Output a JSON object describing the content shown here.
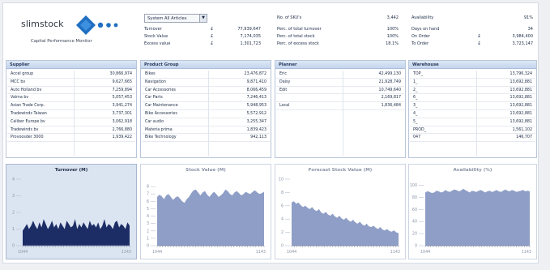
{
  "brand": {
    "name": "slimstock",
    "tagline": "Capital Performance Monitor"
  },
  "filter": {
    "selected": "System All Articles"
  },
  "summary_left": [
    {
      "label": "Turnover",
      "cur": "£",
      "value": "77,939,647"
    },
    {
      "label": "Stock Value",
      "cur": "£",
      "value": "7,174,035"
    },
    {
      "label": "Excess value",
      "cur": "£",
      "value": "1,301,723"
    }
  ],
  "summary_mid": [
    {
      "label": "No. of SKU's",
      "value": "3,442"
    },
    {
      "label": "Perc. of total turnover",
      "value": "100%"
    },
    {
      "label": "Perc. of total stock",
      "value": "100%"
    },
    {
      "label": "Perc. of excess stock",
      "value": "18.1%"
    }
  ],
  "summary_right": [
    {
      "label": "Availability",
      "cur": "",
      "value": "91%"
    },
    {
      "label": "Days on hand",
      "cur": "",
      "value": "34"
    },
    {
      "label": "On Order",
      "cur": "£",
      "value": "3,984,400"
    },
    {
      "label": "To Order",
      "cur": "£",
      "value": "3,723,147"
    }
  ],
  "panels": [
    {
      "title": "Supplier",
      "rows": [
        [
          "Accel group",
          "30,866,974"
        ],
        [
          "MCC bv",
          "9,627,665"
        ],
        [
          "Auto Holland bv",
          "7,259,894"
        ],
        [
          "Valma bv",
          "5,057,453"
        ],
        [
          "Asian Trade Corp.",
          "3,941,274"
        ],
        [
          "Tradewinds Taiwan",
          "3,737,301"
        ],
        [
          "Caliber Europe bv",
          "3,062,918"
        ],
        [
          "Tradewinds bv",
          "2,766,880"
        ],
        [
          "Provoosder 3000",
          "1,939,422"
        ]
      ]
    },
    {
      "title": "Product Group",
      "rows": [
        [
          "Bikes",
          "23,476,872"
        ],
        [
          "Navigation",
          "9,871,410"
        ],
        [
          "Car Accessories",
          "8,066,459"
        ],
        [
          "Car Parts",
          "7,246,413"
        ],
        [
          "Car Maintenance",
          "5,948,953"
        ],
        [
          "Bike Accessories",
          "5,572,912"
        ],
        [
          "Car audio",
          "3,255,347"
        ],
        [
          "Materia prima",
          "1,839,423"
        ],
        [
          "Bike Technology",
          "942,113"
        ]
      ]
    },
    {
      "title": "Planner",
      "rows": [
        [
          "Eric",
          "42,499,130"
        ],
        [
          "Daisy",
          "21,928,749"
        ],
        [
          "Edit",
          "10,749,640"
        ],
        [
          "",
          "2,169,817"
        ],
        [
          "Local",
          "1,836,484"
        ]
      ]
    },
    {
      "title": "Warehouse",
      "rows": [
        [
          "TOP_",
          "13,796,324"
        ],
        [
          "1_",
          "13,692,881"
        ],
        [
          "2_",
          "13,692,881"
        ],
        [
          "6_",
          "13,692,881"
        ],
        [
          "3_",
          "13,692,881"
        ],
        [
          "4_",
          "13,692,881"
        ],
        [
          "5_",
          "13,692,881"
        ],
        [
          "PROD_",
          "1,561,102"
        ],
        [
          "047",
          "146,707"
        ]
      ]
    }
  ],
  "chart_data": [
    {
      "type": "area",
      "title": "Turnover (M)",
      "x_start": "1044",
      "x_end": "1143",
      "ylim": [
        0,
        4
      ],
      "yticks": [
        "0",
        "1",
        "2",
        "3",
        "4"
      ],
      "values": [
        0.9,
        1.1,
        1.3,
        1.0,
        1.2,
        1.5,
        1.2,
        1.0,
        1.4,
        1.1,
        1.6,
        1.3,
        1.0,
        1.2,
        1.5,
        1.1,
        1.3,
        1.0,
        1.4,
        1.2,
        1.0,
        1.5,
        1.3,
        1.1,
        1.2,
        1.6,
        1.0,
        1.3,
        1.1,
        1.4,
        1.2,
        1.0,
        1.5,
        1.2,
        1.3,
        1.1,
        1.4,
        1.0,
        1.2,
        1.6,
        1.1,
        1.3,
        1.2,
        1.0,
        1.4,
        1.5,
        1.1,
        1.3,
        1.2,
        1.0,
        1.4,
        1.2
      ]
    },
    {
      "type": "area",
      "title": "Stock Value (M)",
      "x_start": "1044",
      "x_end": "1143",
      "ylim": [
        0,
        9
      ],
      "yticks": [
        "0",
        "1",
        "2",
        "3",
        "4",
        "5",
        "6",
        "7",
        "8"
      ],
      "values": [
        6.6,
        6.9,
        6.7,
        6.3,
        6.8,
        7.0,
        6.6,
        6.2,
        6.5,
        6.7,
        6.4,
        6.0,
        5.8,
        6.3,
        6.6,
        7.1,
        7.5,
        7.6,
        7.2,
        6.8,
        7.2,
        7.4,
        6.9,
        6.6,
        7.0,
        7.3,
        7.0,
        6.6,
        6.8,
        7.1,
        7.6,
        7.4,
        7.0,
        6.8,
        7.2,
        7.4,
        7.1,
        6.8,
        7.0,
        7.3,
        7.1,
        7.0,
        7.3,
        7.5,
        7.2,
        7.0,
        7.1,
        7.3
      ]
    },
    {
      "type": "area",
      "title": "Forecast Stock Value (M)",
      "x_start": "1044",
      "x_end": "1143",
      "ylim": [
        0,
        10
      ],
      "yticks": [
        "0",
        "2",
        "4",
        "6",
        "8",
        "10"
      ],
      "values": [
        6.5,
        6.7,
        6.3,
        6.5,
        6.1,
        5.8,
        6.0,
        5.7,
        5.5,
        5.8,
        5.4,
        5.2,
        5.5,
        5.0,
        4.8,
        5.1,
        4.7,
        4.5,
        4.8,
        4.4,
        4.2,
        4.5,
        4.1,
        3.9,
        4.2,
        3.8,
        3.6,
        3.9,
        3.5,
        3.3,
        3.6,
        3.2,
        3.0,
        3.3,
        2.9,
        2.8,
        3.0,
        2.7,
        2.5,
        2.8,
        2.4,
        2.3,
        2.5,
        2.2,
        2.1,
        2.3,
        2.0,
        1.9
      ]
    },
    {
      "type": "area",
      "title": "Availability (%)",
      "x_start": "1044",
      "x_end": "1143",
      "ylim": [
        0,
        110
      ],
      "yticks": [
        "0",
        "20",
        "40",
        "60",
        "80",
        "100"
      ],
      "values": [
        88,
        90,
        89,
        87,
        88,
        91,
        90,
        88,
        89,
        92,
        90,
        89,
        91,
        93,
        92,
        90,
        91,
        94,
        92,
        90,
        88,
        91,
        90,
        89,
        91,
        92,
        90,
        88,
        90,
        91,
        89,
        90,
        92,
        90,
        89,
        91,
        93,
        91,
        90,
        92,
        91,
        89,
        90,
        91,
        92,
        90,
        91,
        90
      ]
    }
  ]
}
